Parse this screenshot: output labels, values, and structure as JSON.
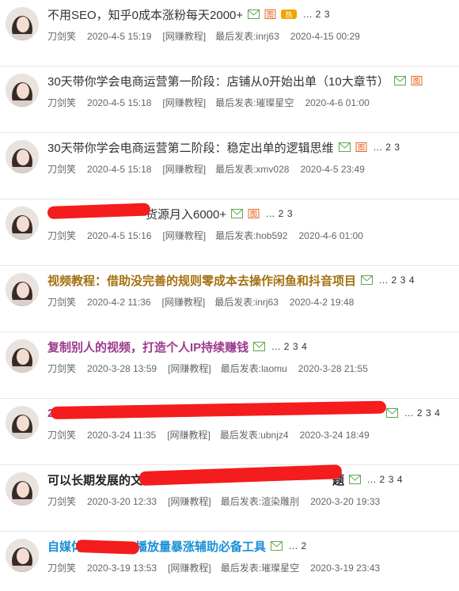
{
  "threads": [
    {
      "title": "不用SEO，知乎0成本涨粉每天2000+",
      "title_style": "normal",
      "author": "刀剑笑",
      "date": "2020-4-5 15:19",
      "forum": "[网赚教程]",
      "last_post": "最后发表:inrj63",
      "last_date": "2020-4-15 00:29",
      "icons": [
        "mail-icon",
        "image-icon",
        "hot-icon"
      ],
      "pages": [
        "...",
        "2",
        "3"
      ]
    },
    {
      "title": "30天带你学会电商运营第一阶段：店铺从0开始出单（10大章节）",
      "title_style": "normal",
      "author": "刀剑笑",
      "date": "2020-4-5 15:18",
      "forum": "[网赚教程]",
      "last_post": "最后发表:璀璨星空",
      "last_date": "2020-4-6 01:00",
      "icons": [
        "mail-icon",
        "image-icon"
      ],
      "pages": []
    },
    {
      "title": "30天带你学会电商运营第二阶段：稳定出单的逻辑思维",
      "title_style": "normal",
      "author": "刀剑笑",
      "date": "2020-4-5 15:18",
      "forum": "[网赚教程]",
      "last_post": "最后发表:xmv028",
      "last_date": "2020-4-5 23:49",
      "icons": [
        "mail-icon",
        "image-icon"
      ],
      "pages": [
        "...",
        "2",
        "3"
      ]
    },
    {
      "title": "货源月入6000+",
      "title_style": "normal",
      "author": "刀剑笑",
      "date": "2020-4-5 15:16",
      "forum": "[网赚教程]",
      "last_post": "最后发表:hob592",
      "last_date": "2020-4-6 01:00",
      "icons": [
        "mail-icon",
        "image-icon"
      ],
      "pages": [
        "...",
        "2",
        "3"
      ]
    },
    {
      "title": "视频教程：借助没完善的规则零成本去操作闲鱼和抖音项目",
      "title_style": "gold",
      "author": "刀剑笑",
      "date": "2020-4-2 11:36",
      "forum": "[网赚教程]",
      "last_post": "最后发表:inrj63",
      "last_date": "2020-4-2 19:48",
      "icons": [
        "mail-icon"
      ],
      "pages": [
        "...",
        "2",
        "3",
        "4"
      ]
    },
    {
      "title": "复制别人的视频，打造个人IP持续赚钱",
      "title_style": "purple",
      "author": "刀剑笑",
      "date": "2020-3-28 13:59",
      "forum": "[网赚教程]",
      "last_post": "最后发表:laomu",
      "last_date": "2020-3-28 21:55",
      "icons": [
        "mail-icon"
      ],
      "pages": [
        "...",
        "2",
        "3",
        "4"
      ]
    },
    {
      "title": "2",
      "title_style": "purple",
      "author": "刀剑笑",
      "date": "2020-3-24 11:35",
      "forum": "[网赚教程]",
      "last_post": "最后发表:ubnjz4",
      "last_date": "2020-3-24 18:49",
      "icons": [
        "mail-icon"
      ],
      "pages": [
        "...",
        "2",
        "3",
        "4"
      ]
    },
    {
      "title": "可以长期发展的文",
      "title_tail": "题",
      "title_style": "dark",
      "author": "刀剑笑",
      "date": "2020-3-20 12:33",
      "forum": "[网赚教程]",
      "last_post": "最后发表:渲染雕刖",
      "last_date": "2020-3-20 19:33",
      "icons": [
        "mail-icon"
      ],
      "pages": [
        "...",
        "2",
        "3",
        "4"
      ]
    },
    {
      "title": "自媒体",
      "title_tail": "播放量暴涨辅助必备工具",
      "title_style": "blue",
      "author": "刀剑笑",
      "date": "2020-3-19 13:53",
      "forum": "[网赚教程]",
      "last_post": "最后发表:璀璨星空",
      "last_date": "2020-3-19 23:43",
      "icons": [
        "mail-icon"
      ],
      "pages": [
        "...",
        "2"
      ]
    }
  ],
  "colors": {
    "mail": "#5fa84a",
    "image": "#e25b12",
    "hot": "#f0a500",
    "redaction": "#f41c1c",
    "separator": "#e6e6e6"
  }
}
